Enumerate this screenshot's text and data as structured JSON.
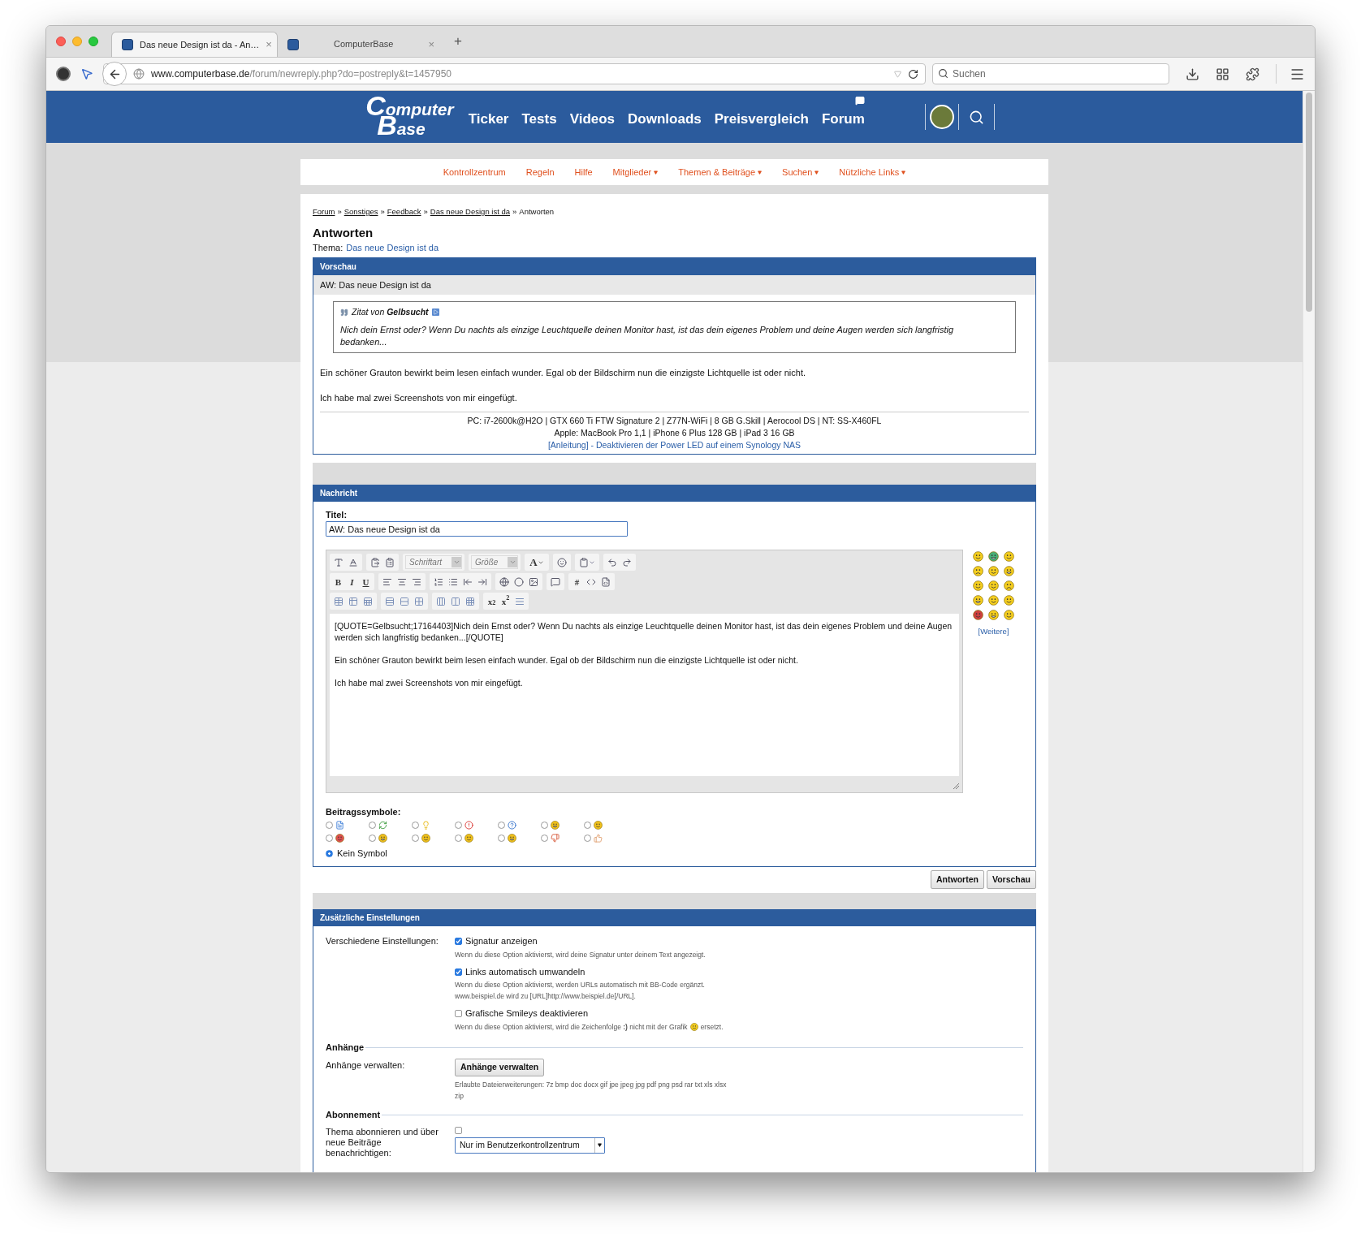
{
  "browser": {
    "tabs": [
      {
        "title": "Das neue Design ist da - An…",
        "close": "×",
        "selected": true
      },
      {
        "title": "ComputerBase",
        "close": "×",
        "selected": false
      }
    ],
    "new_tab": "+",
    "url": {
      "domain": "www.computerbase.de",
      "path": "/forum/newreply.php?do=postreply&t=1457950"
    },
    "search": {
      "placeholder": "Suchen"
    }
  },
  "header": {
    "logo": [
      "Computer",
      "Base"
    ],
    "nav": [
      {
        "label": "Ticker",
        "kind": "plain"
      },
      {
        "label": "Tests",
        "kind": "plain"
      },
      {
        "label": "Videos",
        "kind": "plain"
      },
      {
        "label": "Downloads",
        "kind": "plain"
      },
      {
        "label": "Preisvergleich",
        "kind": "plain"
      },
      {
        "label": "Forum",
        "kind": "with-icon"
      }
    ]
  },
  "subnav": [
    {
      "label": "Kontrollzentrum",
      "dropdown": false
    },
    {
      "label": "Regeln",
      "dropdown": false
    },
    {
      "label": "Hilfe",
      "dropdown": false
    },
    {
      "label": "Mitglieder",
      "dropdown": true
    },
    {
      "label": "Themen & Beiträge",
      "dropdown": true
    },
    {
      "label": "Suchen",
      "dropdown": true
    },
    {
      "label": "Nützliche Links",
      "dropdown": true
    }
  ],
  "breadcrumb": [
    {
      "text": "Forum",
      "kind": "link"
    },
    {
      "text": "»",
      "kind": "separator"
    },
    {
      "text": "Sonstiges",
      "kind": "link"
    },
    {
      "text": "»",
      "kind": "separator"
    },
    {
      "text": "Feedback",
      "kind": "link"
    },
    {
      "text": "»",
      "kind": "separator"
    },
    {
      "text": "Das neue Design ist da",
      "kind": "link"
    },
    {
      "text": "»",
      "kind": "separator"
    },
    {
      "text": "Antworten",
      "kind": "current"
    }
  ],
  "page": {
    "title": "Antworten",
    "thema_label": "Thema:",
    "thema_link": "Das neue Design ist da"
  },
  "preview": {
    "header": "Vorschau",
    "subject": "AW: Das neue Design ist da",
    "quote": {
      "prefix": "Zitat von",
      "author": "Gelbsucht",
      "text": "Nich dein Ernst oder? Wenn Du nachts als einzige Leuchtquelle deinen Monitor hast, ist das dein eigenes Problem und deine Augen werden sich langfristig bedanken..."
    },
    "paragraphs": [
      "Ein schöner Grauton bewirkt beim lesen einfach wunder. Egal ob der Bildschirm nun die einzigste Lichtquelle ist oder nicht.",
      "Ich habe mal zwei Screenshots von mir eingefügt."
    ],
    "signature": [
      "PC: i7-2600k@H2O | GTX 660 Ti FTW Signature 2 | Z77N-WiFi | 8 GB G.Skill | Aerocool DS | NT: SS-X460FL",
      "Apple: MacBook Pro 1,1 | iPhone 6 Plus 128 GB | iPad 3 16 GB"
    ],
    "signature_link": "[Anleitung] - Deaktivieren der Power LED auf einem Synology NAS"
  },
  "message": {
    "header": "Nachricht",
    "title_label": "Titel:",
    "title_value": "AW: Das neue Design ist da",
    "toolbar": [
      [
        [
          {
            "kind": "icon"
          },
          {
            "kind": "icon"
          }
        ],
        [
          {
            "kind": "icon"
          },
          {
            "kind": "icon"
          }
        ],
        [
          {
            "kind": "select",
            "text": "Schriftart"
          }
        ],
        [
          {
            "kind": "select",
            "text": "Größe"
          }
        ],
        [
          {
            "kind": "label-dropdown",
            "text": "A"
          }
        ],
        [
          {
            "kind": "icon"
          }
        ],
        [
          {
            "kind": "icon-dropdown"
          }
        ],
        [
          {
            "kind": "icon"
          },
          {
            "kind": "icon"
          }
        ]
      ],
      [
        [
          {
            "kind": "label",
            "text": "B"
          },
          {
            "kind": "label",
            "text": "I"
          },
          {
            "kind": "label",
            "text": "U"
          }
        ],
        [
          {
            "kind": "icon"
          },
          {
            "kind": "icon"
          },
          {
            "kind": "icon"
          }
        ],
        [
          {
            "kind": "icon"
          },
          {
            "kind": "icon"
          },
          {
            "kind": "icon"
          },
          {
            "kind": "icon"
          }
        ],
        [
          {
            "kind": "icon"
          },
          {
            "kind": "icon"
          },
          {
            "kind": "icon"
          }
        ],
        [
          {
            "kind": "icon"
          }
        ],
        [
          {
            "kind": "label",
            "text": "#"
          },
          {
            "kind": "icon"
          },
          {
            "kind": "icon"
          }
        ]
      ],
      [
        [
          {
            "kind": "icon"
          },
          {
            "kind": "icon"
          },
          {
            "kind": "icon"
          }
        ],
        [
          {
            "kind": "icon"
          },
          {
            "kind": "icon"
          },
          {
            "kind": "icon"
          }
        ],
        [
          {
            "kind": "icon"
          },
          {
            "kind": "icon"
          },
          {
            "kind": "icon"
          }
        ],
        [
          {
            "kind": "label",
            "text": "x$_{2}$"
          },
          {
            "kind": "label",
            "text": "x$^{2}$"
          },
          {
            "kind": "icon"
          }
        ]
      ]
    ],
    "body": "[QUOTE=Gelbsucht;17164403]Nich dein Ernst oder? Wenn Du nachts als einzige Leuchtquelle deinen Monitor hast, ist das dein eigenes Problem und deine Augen werden sich langfristig bedanken...[/QUOTE]\n\nEin schöner Grauton bewirkt beim lesen einfach wunder. Egal ob der Bildschirm nun die einzigste Lichtquelle ist oder nicht.\n\nIch habe mal zwei Screenshots von mir eingefügt.",
    "smilies_more": "[Weitere]",
    "post_icons_label": "Beitragssymbole:",
    "post_icons": [
      {
        "selected": false
      },
      {
        "selected": false
      },
      {
        "selected": false
      },
      {
        "selected": false
      },
      {
        "selected": false
      },
      {
        "selected": false
      },
      {
        "selected": false
      },
      {
        "selected": false
      },
      {
        "selected": false
      },
      {
        "selected": false
      },
      {
        "selected": false
      },
      {
        "selected": false
      },
      {
        "selected": false
      },
      {
        "selected": false
      }
    ],
    "no_icon": {
      "label": "Kein Symbol",
      "selected": true
    }
  },
  "buttons": [
    "Antworten",
    "Vorschau"
  ],
  "settings": {
    "header": "Zusätzliche Einstellungen",
    "misc_label": "Verschiedene Einstellungen:",
    "options": [
      {
        "label": "Signatur anzeigen",
        "checked": true,
        "description": [
          "Wenn du diese Option aktivierst, wird deine Signatur unter deinem Text angezeigt."
        ]
      },
      {
        "label": "Links automatisch umwandeln",
        "checked": true,
        "description": [
          "Wenn du diese Option aktivierst, werden URLs automatisch mit BB-Code ergänzt.",
          "www.beispiel.de wird zu [URL]http://www.beispiel.de[/URL]."
        ]
      },
      {
        "label": "Grafische Smileys deaktivieren",
        "checked": false,
        "description": [
          "Wenn du diese Option aktivierst, wird die Zeichenfolge **:)** nicht mit der Grafik"
        ],
        "description_end": "ersetzt."
      }
    ],
    "attachments": {
      "heading": "Anhänge",
      "label": "Anhänge verwalten:",
      "button": "Anhänge verwalten",
      "allowed": "Erlaubte Dateierweiterungen: 7z bmp doc docx gif jpe jpeg jpg pdf png psd rar txt xls xlsx",
      "allowed_wrap": "zip"
    },
    "subscription": {
      "heading": "Abonnement",
      "label": "Thema abonnieren und über neue Beiträge benachrichtigen:",
      "checked": false,
      "select": "Nur im Benutzerkontrollzentrum"
    }
  }
}
